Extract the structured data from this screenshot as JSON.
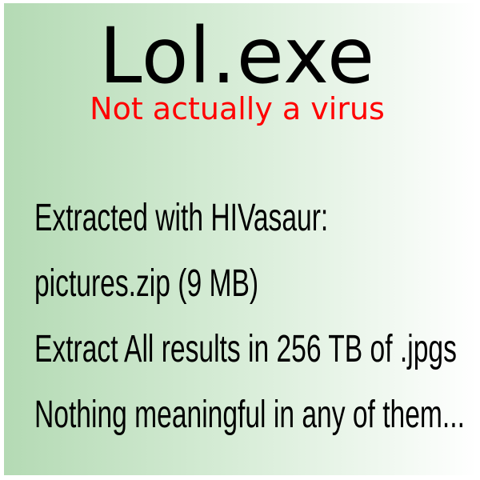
{
  "title": "Lol.exe",
  "subtitle": "Not actually a virus",
  "lines": [
    "Extracted with HIVasaur:",
    "pictures.zip (9 MB)",
    "Extract All results in 256 TB of .jpgs",
    "Nothing meaningful in any of them..."
  ],
  "colors": {
    "title": "#000000",
    "subtitle": "#ff0000",
    "gradient_start": "#b4dab4",
    "gradient_end": "#ffffff"
  }
}
